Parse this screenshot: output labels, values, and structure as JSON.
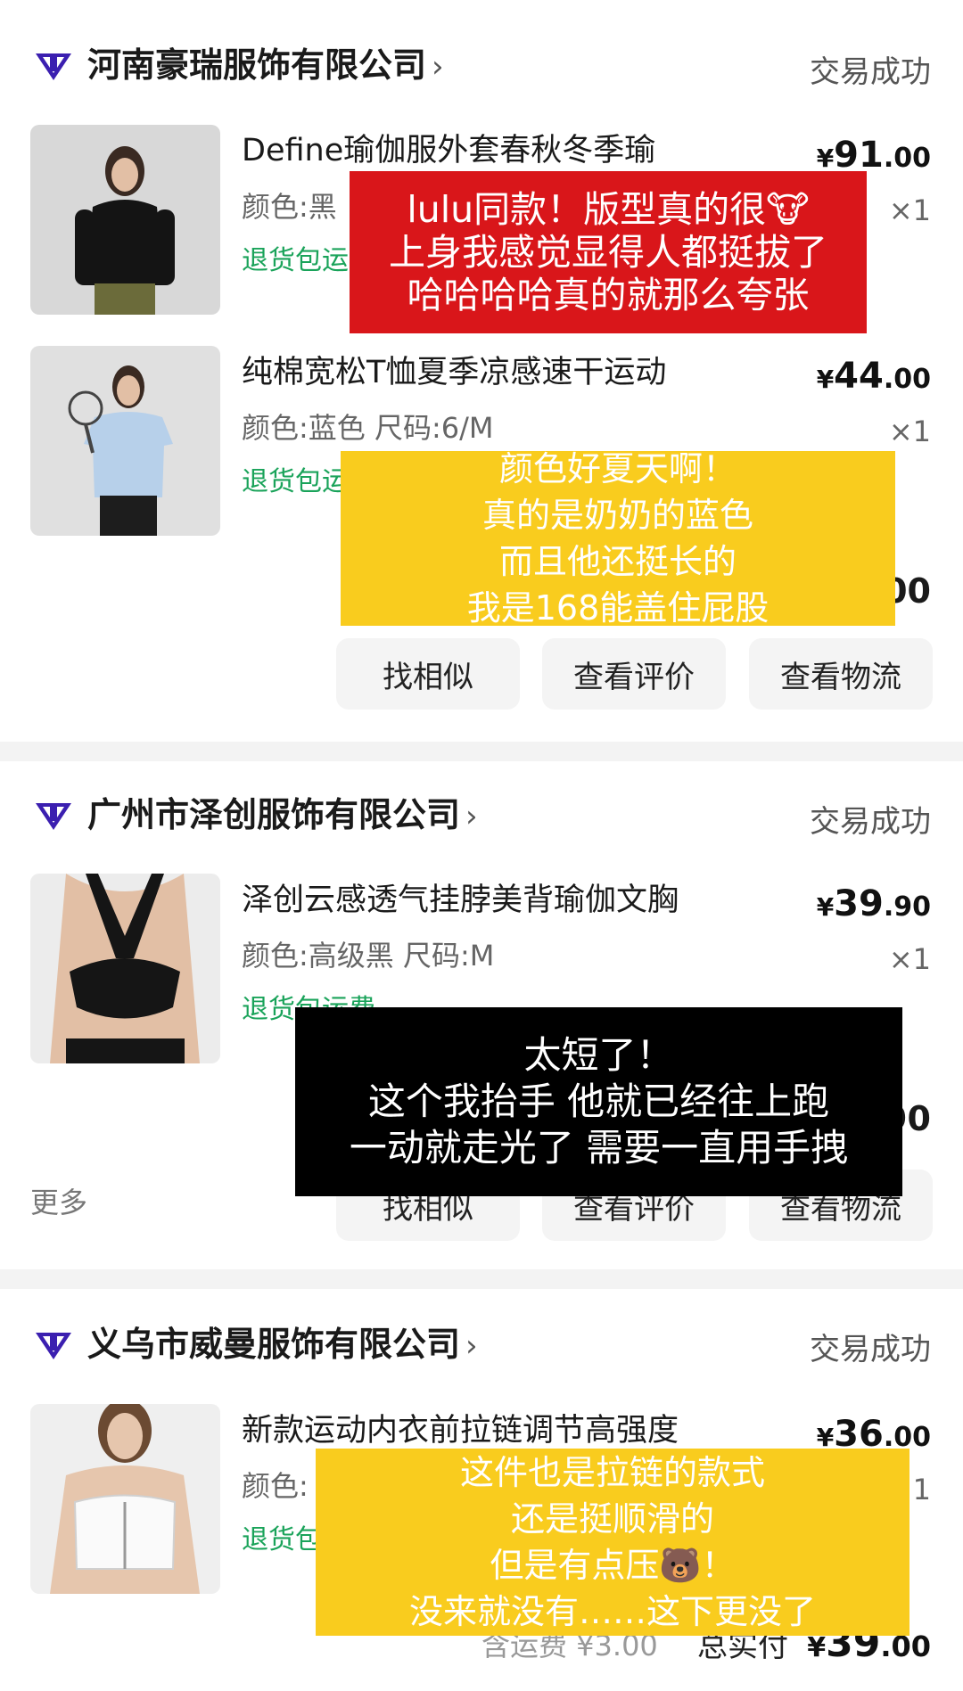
{
  "colors": {
    "accent_green": "#1aa35a",
    "overlay_red": "#d9161a",
    "overlay_yellow": "#f9cc1e",
    "overlay_black": "#000000",
    "logo": "#3b1fb0"
  },
  "orders": [
    {
      "store": "河南豪瑞服饰有限公司",
      "status": "交易成功",
      "items": [
        {
          "title": "Define瑜伽服外套春秋冬季瑜",
          "spec": "颜色:黑",
          "free": "退货包运",
          "price_int": "91",
          "price_dec": ".00",
          "qty": "×1"
        },
        {
          "title": "纯棉宽松T恤夏季凉感速干运动",
          "spec": "颜色:蓝色 尺码:6/M",
          "free": "退货包运",
          "price_int": "44",
          "price_dec": ".00",
          "qty": "×1"
        }
      ],
      "total_tail": "00",
      "buttons": [
        "找相似",
        "查看评价",
        "查看物流"
      ]
    },
    {
      "store": "广州市泽创服饰有限公司",
      "status": "交易成功",
      "items": [
        {
          "title": "泽创云感透气挂脖美背瑜伽文胸",
          "spec": "颜色:高级黑 尺码:M",
          "free": "退货包运费",
          "price_int": "39",
          "price_dec": ".90",
          "qty": "×1"
        }
      ],
      "total_tail": "90",
      "more": "更多",
      "buttons": [
        "找相似",
        "查看评价",
        "查看物流"
      ]
    },
    {
      "store": "义乌市威曼服饰有限公司",
      "status": "交易成功",
      "items": [
        {
          "title": "新款运动内衣前拉链调节高强度",
          "spec": "颜色:",
          "free": "退货包",
          "price_int": "36",
          "price_dec": ".00",
          "qty": "×1"
        }
      ],
      "shipping": "含运费 ¥3.00",
      "total_label": "总实付",
      "total_int": "39",
      "total_dec": ".00"
    }
  ],
  "overlays": {
    "red": [
      "lulu同款！版型真的很🐮",
      "上身我感觉显得人都挺拔了",
      "哈哈哈哈真的就那么夸张"
    ],
    "yellow1": [
      "颜色好夏天啊！",
      "真的是奶奶的蓝色",
      "而且他还挺长的",
      "我是168能盖住屁股"
    ],
    "black": [
      "太短了！",
      "这个我抬手 他就已经往上跑",
      "一动就走光了 需要一直用手拽"
    ],
    "yellow2": [
      "这件也是拉链的款式",
      "还是挺顺滑的",
      "但是有点压🐻！",
      "没来就没有……这下更没了"
    ]
  }
}
